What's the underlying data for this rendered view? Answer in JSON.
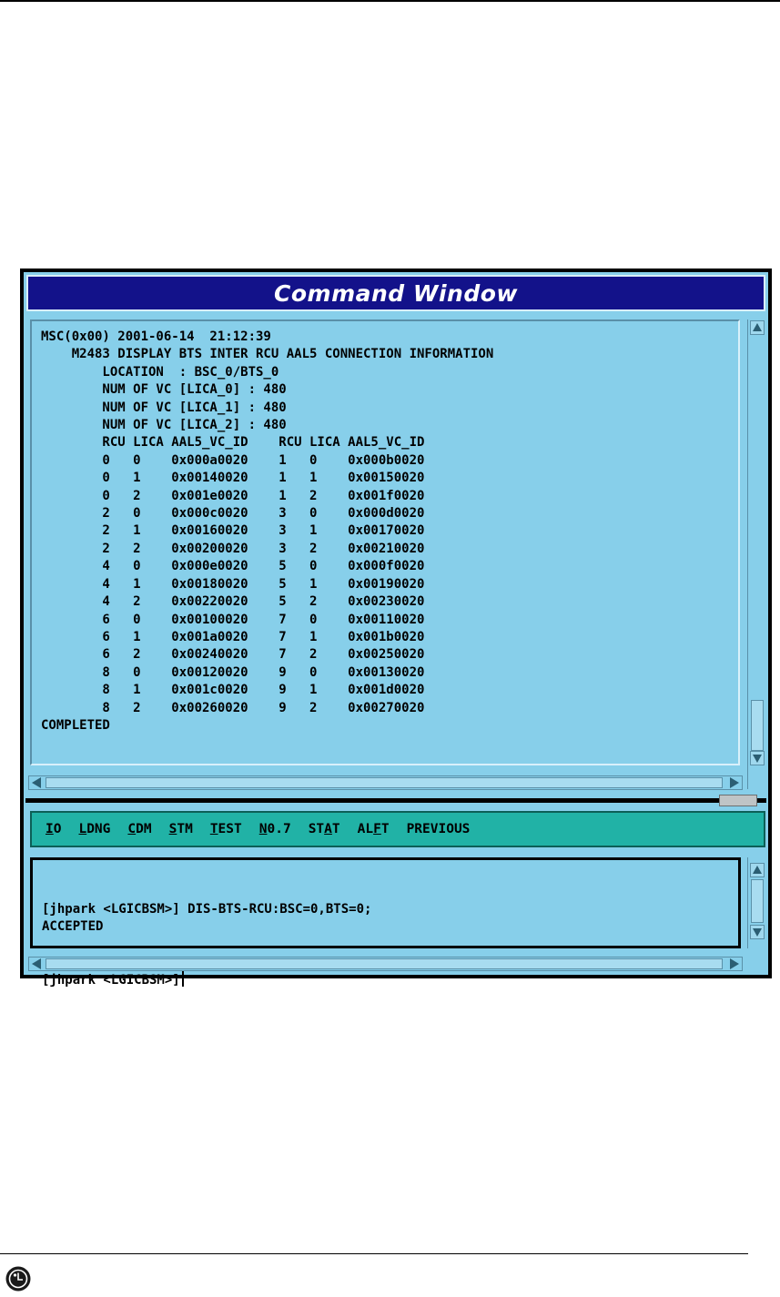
{
  "window": {
    "title": "Command Window"
  },
  "output": {
    "lines": [
      "MSC(0x00) 2001-06-14  21:12:39",
      "    M2483 DISPLAY BTS INTER RCU AAL5 CONNECTION INFORMATION",
      "        LOCATION  : BSC_0/BTS_0",
      "        NUM OF VC [LICA_0] : 480",
      "        NUM OF VC [LICA_1] : 480",
      "        NUM OF VC [LICA_2] : 480",
      "        RCU LICA AAL5_VC_ID    RCU LICA AAL5_VC_ID",
      "        0   0    0x000a0020    1   0    0x000b0020",
      "        0   1    0x00140020    1   1    0x00150020",
      "        0   2    0x001e0020    1   2    0x001f0020",
      "        2   0    0x000c0020    3   0    0x000d0020",
      "        2   1    0x00160020    3   1    0x00170020",
      "        2   2    0x00200020    3   2    0x00210020",
      "        4   0    0x000e0020    5   0    0x000f0020",
      "        4   1    0x00180020    5   1    0x00190020",
      "        4   2    0x00220020    5   2    0x00230020",
      "        6   0    0x00100020    7   0    0x00110020",
      "        6   1    0x001a0020    7   1    0x001b0020",
      "        6   2    0x00240020    7   2    0x00250020",
      "        8   0    0x00120020    9   0    0x00130020",
      "        8   1    0x001c0020    9   1    0x001d0020",
      "        8   2    0x00260020    9   2    0x00270020",
      "COMPLETED"
    ]
  },
  "menu": {
    "items": [
      {
        "pre": "",
        "ul": "I",
        "post": "O"
      },
      {
        "pre": "",
        "ul": "L",
        "post": "DNG"
      },
      {
        "pre": "",
        "ul": "C",
        "post": "DM"
      },
      {
        "pre": "",
        "ul": "S",
        "post": "TM"
      },
      {
        "pre": "",
        "ul": "T",
        "post": "EST"
      },
      {
        "pre": "",
        "ul": "N",
        "post": "0.7"
      },
      {
        "pre": "ST",
        "ul": "A",
        "post": "T"
      },
      {
        "pre": "AL",
        "ul": "F",
        "post": "T"
      },
      {
        "pre": "PREVIOUS",
        "ul": "",
        "post": ""
      }
    ]
  },
  "input": {
    "history": [
      "[jhpark <LGICBSM>] DIS-BTS-RCU:BSC=0,BTS=0;",
      "ACCEPTED"
    ],
    "prompt": "[jhpark <LGICBSM>]"
  },
  "logo": {
    "text": "LG"
  }
}
